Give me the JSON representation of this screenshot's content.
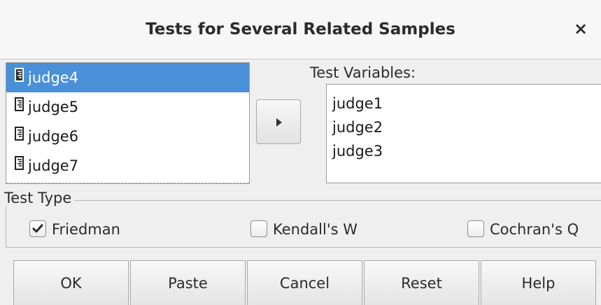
{
  "window": {
    "title": "Tests for Several Related Samples",
    "close_glyph": "×"
  },
  "source_list": {
    "items": [
      {
        "label": "judge4",
        "selected": true
      },
      {
        "label": "judge5",
        "selected": false
      },
      {
        "label": "judge6",
        "selected": false
      },
      {
        "label": "judge7",
        "selected": false
      }
    ]
  },
  "move_button": {
    "icon": "triangle-right-icon"
  },
  "test_variables": {
    "label": "Test Variables:",
    "items": [
      "judge1",
      "judge2",
      "judge3"
    ]
  },
  "test_type": {
    "legend": "Test Type",
    "options": [
      {
        "label": "Friedman",
        "checked": true
      },
      {
        "label": "Kendall's W",
        "checked": false
      },
      {
        "label": "Cochran's Q",
        "checked": false
      }
    ]
  },
  "buttons": {
    "ok": "OK",
    "paste": "Paste",
    "cancel": "Cancel",
    "reset": "Reset",
    "help": "Help"
  },
  "colors": {
    "selection": "#4a90d9",
    "background": "#efefef"
  }
}
